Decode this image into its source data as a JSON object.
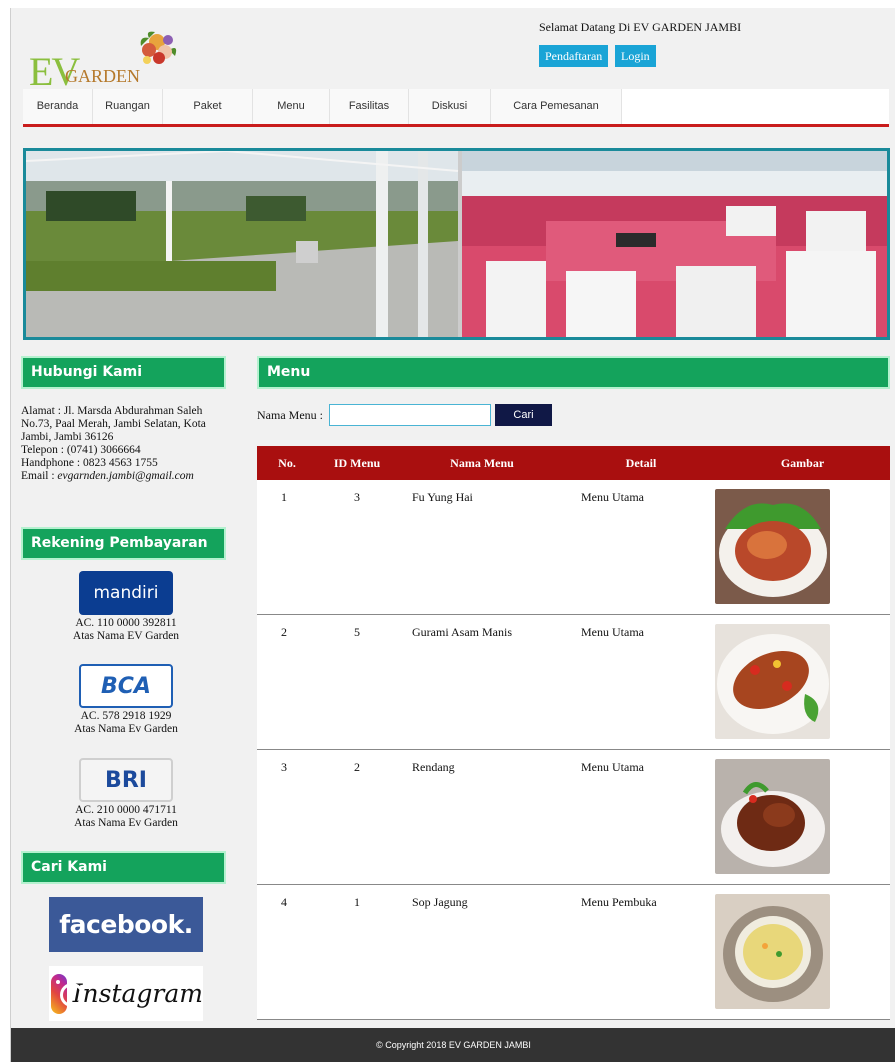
{
  "header": {
    "logo_text": "EVGARDEN",
    "welcome": "Selamat Datang Di EV GARDEN JAMBI",
    "register_label": "Pendaftaran",
    "login_label": "Login"
  },
  "nav": [
    "Beranda",
    "Ruangan",
    "Paket",
    "Menu",
    "Fasilitas",
    "Diskusi",
    "Cara Pemesanan"
  ],
  "sidebar": {
    "contact_title": "Hubungi Kami",
    "address": "Alamat : Jl. Marsda Abdurahman Saleh No.73, Paal Merah, Jambi Selatan, Kota Jambi, Jambi 36126",
    "phone": "Telepon : (0741) 3066664",
    "handphone": "Handphone : 0823 4563 1755",
    "email_label": "Email : ",
    "email": "evgarnden.jambi@gmail.com",
    "payment_title": "Rekening Pembayaran",
    "banks": [
      {
        "logo": "mandiri",
        "account": "AC. 110 0000 392811",
        "holder": "Atas Nama EV Garden"
      },
      {
        "logo": "BCA",
        "account": "AC. 578 2918 1929",
        "holder": "Atas Nama Ev Garden"
      },
      {
        "logo": "BRI",
        "account": "AC. 210 0000 471711",
        "holder": "Atas Nama Ev Garden"
      }
    ],
    "find_title": "Cari Kami",
    "facebook": "facebook.",
    "instagram": "Instagram"
  },
  "main": {
    "title": "Menu",
    "search_label": "Nama Menu :",
    "search_value": "",
    "search_button": "Cari",
    "columns": [
      "No.",
      "ID Menu",
      "Nama Menu",
      "Detail",
      "Gambar"
    ],
    "rows": [
      {
        "no": "1",
        "id": "3",
        "name": "Fu Yung Hai",
        "detail": "Menu Utama"
      },
      {
        "no": "2",
        "id": "5",
        "name": "Gurami Asam Manis",
        "detail": "Menu Utama"
      },
      {
        "no": "3",
        "id": "2",
        "name": "Rendang",
        "detail": "Menu Utama"
      },
      {
        "no": "4",
        "id": "1",
        "name": "Sop Jagung",
        "detail": "Menu Pembuka"
      }
    ]
  },
  "footer": {
    "copyright": "© Copyright 2018 EV GARDEN JAMBI"
  },
  "colors": {
    "accent_green": "#14a35c",
    "nav_red": "#c91c1c",
    "table_head": "#a90f0f",
    "button_blue": "#1aa4d6"
  }
}
